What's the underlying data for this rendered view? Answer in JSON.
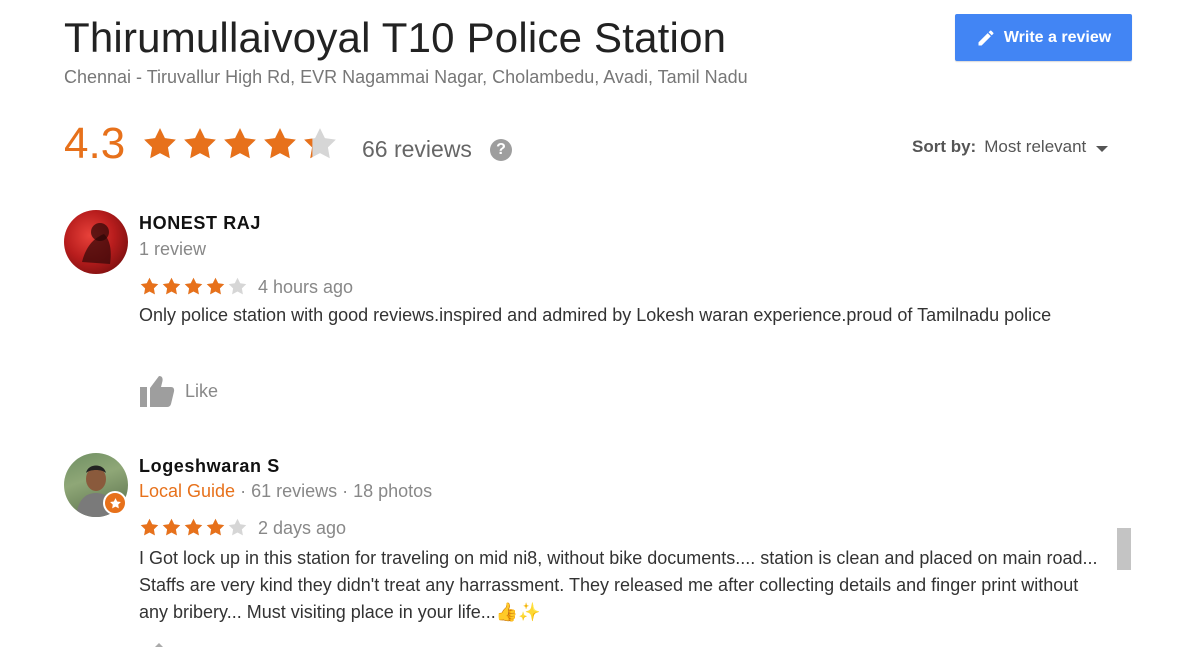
{
  "place": {
    "title": "Thirumullaivoyal T10 Police Station",
    "address": "Chennai - Tiruvallur High Rd, EVR Nagammai Nagar, Cholambedu, Avadi, Tamil Nadu"
  },
  "actions": {
    "write_review_label": "Write a review",
    "write_review_icon": "pencil-icon"
  },
  "rating": {
    "value": "4.3",
    "stars": 4.3,
    "review_count": "66 reviews",
    "help_icon": "?"
  },
  "sort": {
    "label": "Sort by:",
    "value": "Most relevant"
  },
  "colors": {
    "star_filled": "#e7711b",
    "star_empty": "#d6d6d6",
    "button_blue": "#4285f4",
    "local_guide": "#e7711b"
  },
  "reviews": [
    {
      "name": "HONEST RAJ",
      "meta": "1 review",
      "stars": 4,
      "time": "4 hours ago",
      "text": "Only police station with good reviews.inspired and admired by Lokesh waran experience.proud of Tamilnadu police",
      "like_label": "Like"
    },
    {
      "name": "Logeshwaran S",
      "guide_label": "Local Guide",
      "meta": " · 61 reviews · 18 photos",
      "stars": 4,
      "time": "2 days ago",
      "text": "I Got lock up in this station for traveling on mid ni8, without bike documents.... station is clean and placed on main road... Staffs are very kind they didn't treat any harrassment. They released me after collecting details and finger print without any bribery... Must visiting place in your life...👍✨"
    }
  ]
}
